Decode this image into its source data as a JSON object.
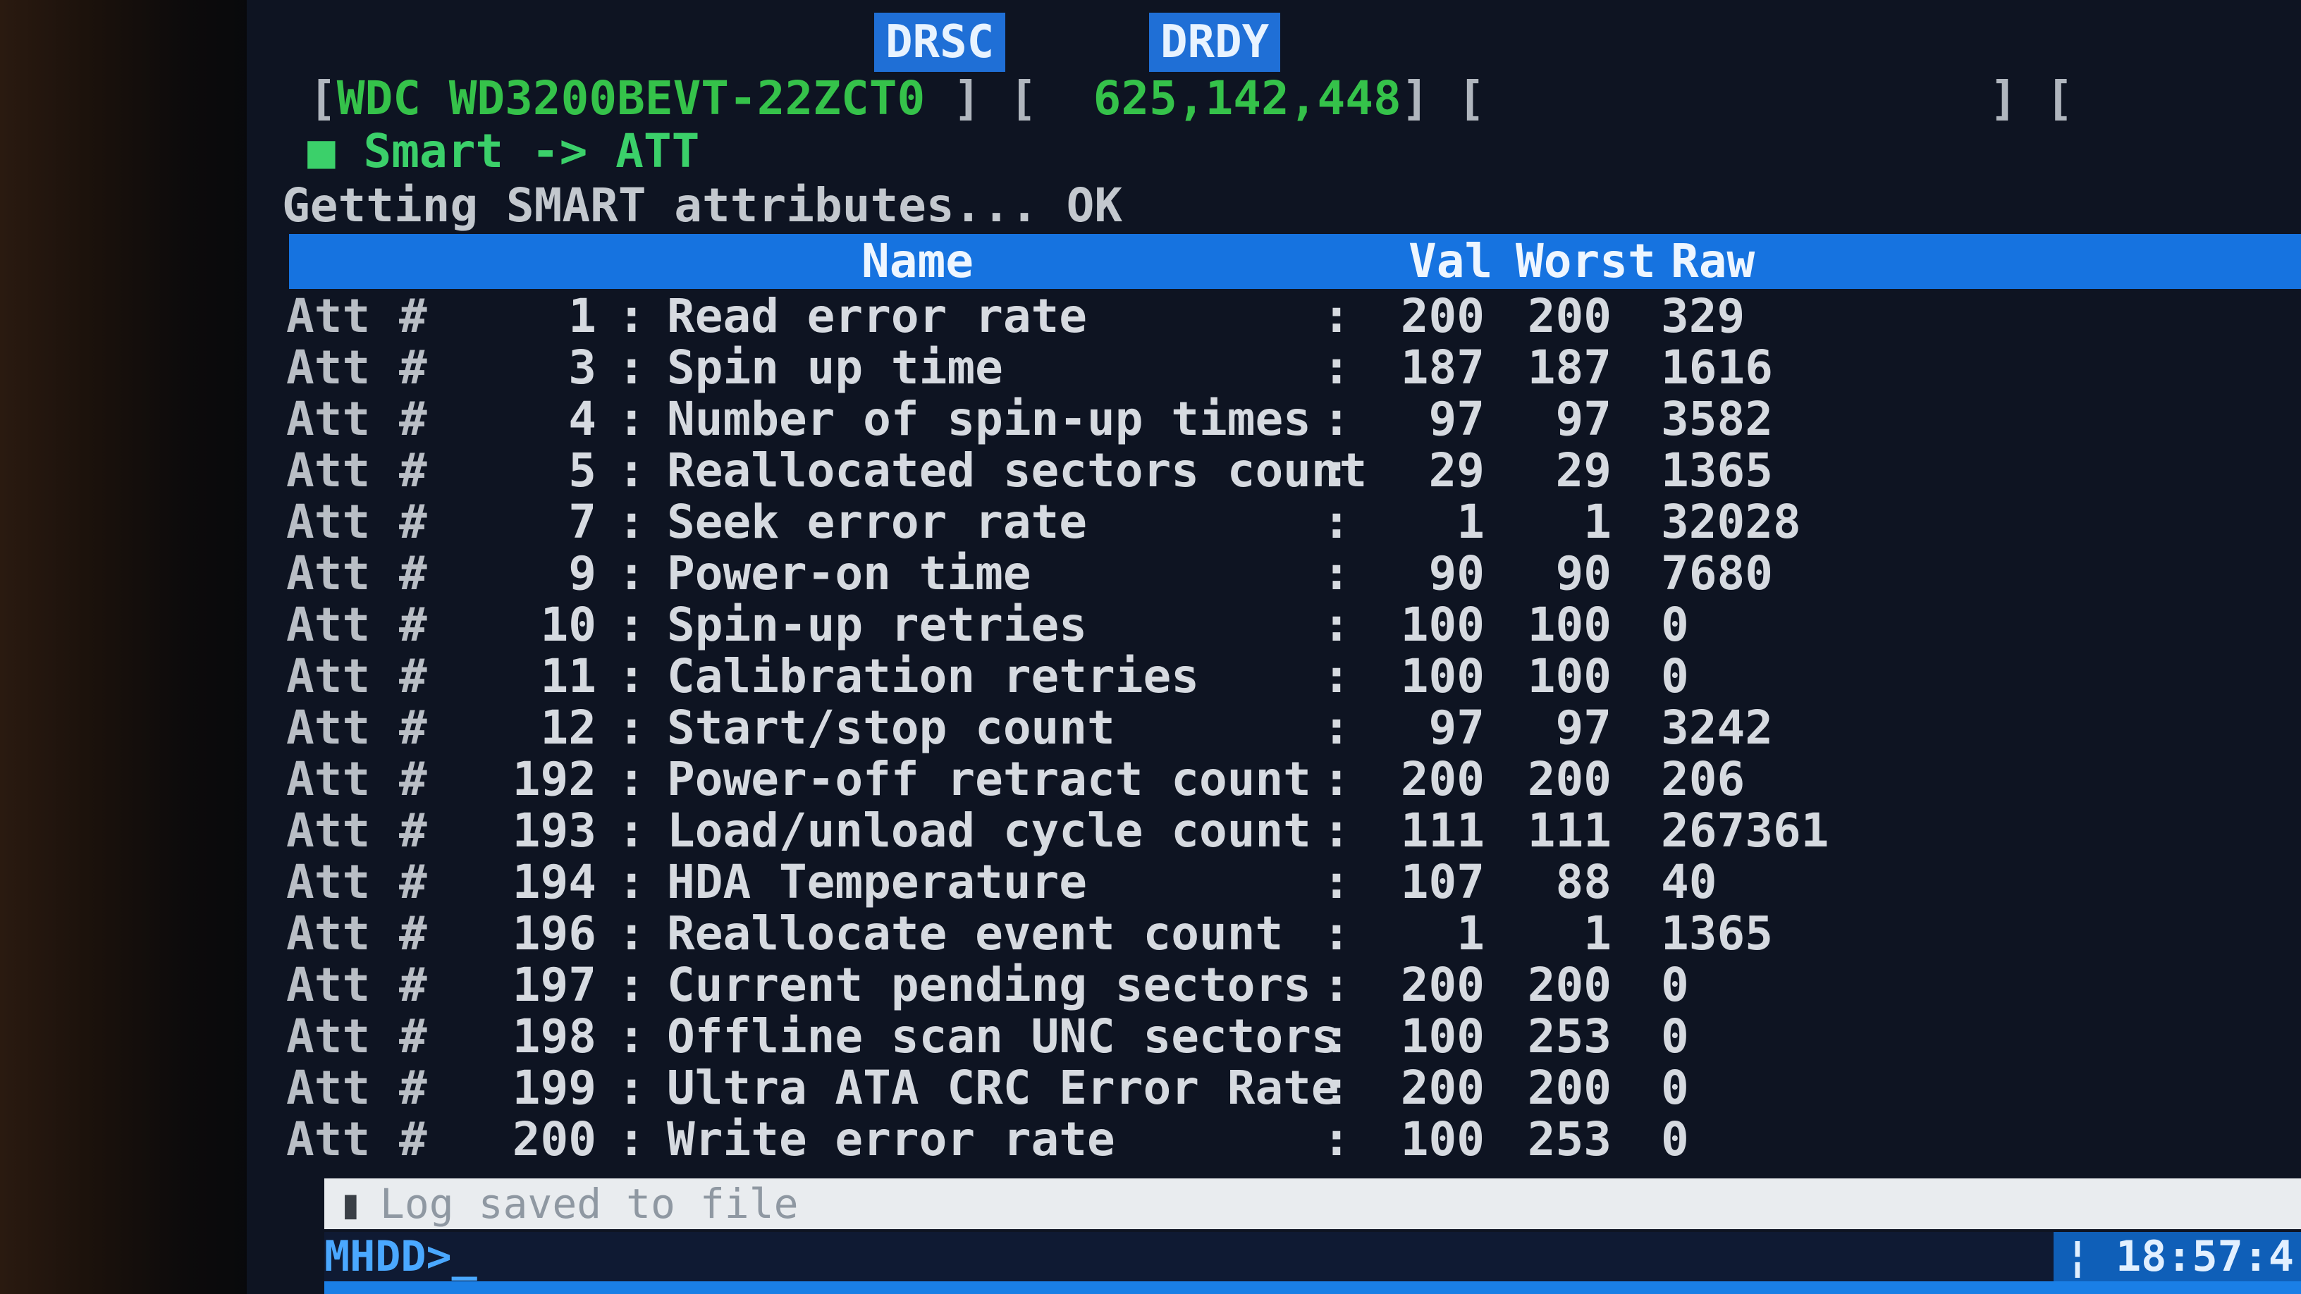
{
  "status_flags": [
    "DRSC",
    "DRDY"
  ],
  "drive": {
    "model": "WDC WD3200BEVT-22ZCT0",
    "lba": "625,142,448"
  },
  "breadcrumb": {
    "root": "Smart",
    "arrow": "->",
    "current": "ATT"
  },
  "message": "Getting SMART attributes... OK",
  "table": {
    "columns": {
      "name": "Name",
      "val": "Val",
      "worst": "Worst",
      "raw": "Raw"
    },
    "row_prefix": "Att",
    "row_hash": "#",
    "rows": [
      {
        "id": "1",
        "name": "Read error rate",
        "val": "200",
        "worst": "200",
        "raw": "329"
      },
      {
        "id": "3",
        "name": "Spin up time",
        "val": "187",
        "worst": "187",
        "raw": "1616"
      },
      {
        "id": "4",
        "name": "Number of spin-up times",
        "val": "97",
        "worst": "97",
        "raw": "3582"
      },
      {
        "id": "5",
        "name": "Reallocated sectors count",
        "val": "29",
        "worst": "29",
        "raw": "1365"
      },
      {
        "id": "7",
        "name": "Seek error rate",
        "val": "1",
        "worst": "1",
        "raw": "32028"
      },
      {
        "id": "9",
        "name": "Power-on time",
        "val": "90",
        "worst": "90",
        "raw": "7680"
      },
      {
        "id": "10",
        "name": "Spin-up retries",
        "val": "100",
        "worst": "100",
        "raw": "0"
      },
      {
        "id": "11",
        "name": "Calibration retries",
        "val": "100",
        "worst": "100",
        "raw": "0"
      },
      {
        "id": "12",
        "name": "Start/stop count",
        "val": "97",
        "worst": "97",
        "raw": "3242"
      },
      {
        "id": "192",
        "name": "Power-off retract count",
        "val": "200",
        "worst": "200",
        "raw": "206"
      },
      {
        "id": "193",
        "name": "Load/unload cycle count",
        "val": "111",
        "worst": "111",
        "raw": "267361"
      },
      {
        "id": "194",
        "name": "HDA Temperature",
        "val": "107",
        "worst": "88",
        "raw": "40"
      },
      {
        "id": "196",
        "name": "Reallocate event count",
        "val": "1",
        "worst": "1",
        "raw": "1365"
      },
      {
        "id": "197",
        "name": "Current pending sectors",
        "val": "200",
        "worst": "200",
        "raw": "0"
      },
      {
        "id": "198",
        "name": "Offline scan UNC sectors",
        "val": "100",
        "worst": "253",
        "raw": "0"
      },
      {
        "id": "199",
        "name": "Ultra ATA CRC Error Rate",
        "val": "200",
        "worst": "200",
        "raw": "0"
      },
      {
        "id": "200",
        "name": "Write error rate",
        "val": "100",
        "worst": "253",
        "raw": "0"
      }
    ]
  },
  "log_message": "Log saved to file",
  "prompt": "MHDD>",
  "clock": "18:57:4"
}
